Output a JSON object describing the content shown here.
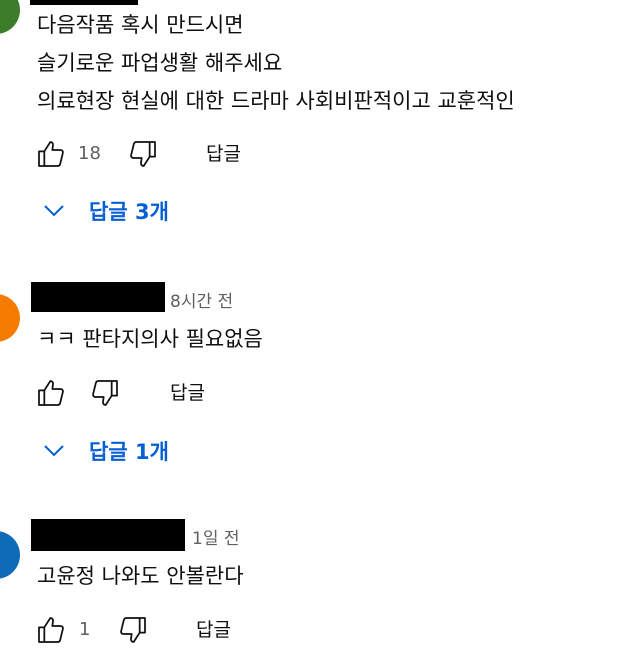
{
  "colors": {
    "link_blue": "#065fd4",
    "meta_gray": "#606060",
    "avatar_green": "#3b7d2a",
    "avatar_orange": "#f57c00",
    "avatar_blue": "#0d6bb8"
  },
  "comments": [
    {
      "avatar_color": "#3b7d2a",
      "time": "",
      "lines": [
        "다음작품 혹시 만드시면",
        "슬기로운 파업생활 해주세요",
        "의료현장 현실에 대한 드라마 사회비판적이고 교훈적인"
      ],
      "like_count": "18",
      "reply_label": "답글",
      "replies_label": "답글 3개"
    },
    {
      "avatar_color": "#f57c00",
      "time": "8시간 전",
      "lines": [
        "ㅋㅋ 판타지의사 필요없음"
      ],
      "like_count": "",
      "reply_label": "답글",
      "replies_label": "답글 1개"
    },
    {
      "avatar_color": "#0d6bb8",
      "time": "1일 전",
      "lines": [
        "고윤정 나와도 안볼란다"
      ],
      "like_count": "1",
      "reply_label": "답글"
    }
  ]
}
